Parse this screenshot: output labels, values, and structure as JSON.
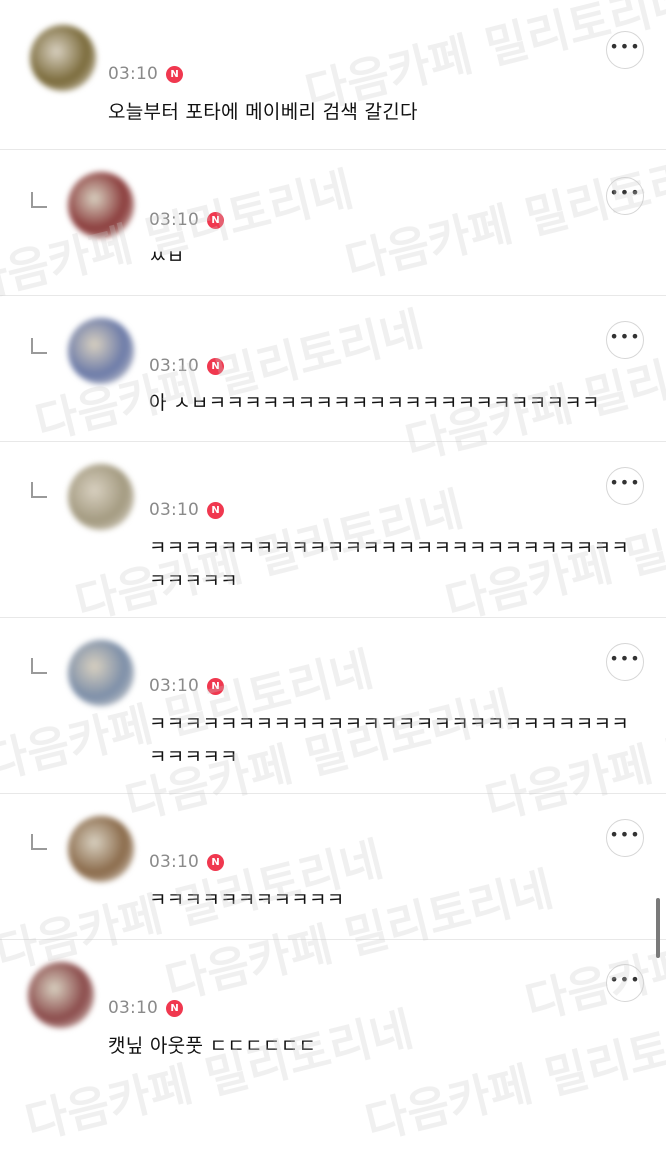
{
  "watermark": "다음카페 밀리토리네",
  "comments": [
    {
      "time": "03:10",
      "badge": "N",
      "text": "오늘부터 포타에 메이베리 검색 갈긴다",
      "avatar_color": "#7a6a3a",
      "reply": false
    },
    {
      "time": "03:10",
      "badge": "N",
      "text": "ㅆㅂ",
      "avatar_color": "#8a3b3b",
      "reply": true
    },
    {
      "time": "03:10",
      "badge": "N",
      "text": "아 ㅅㅂㅋㅋㅋㅋㅋㅋㅋㅋㅋㅋㅋㅋㅋㅋㅋㅋㅋㅋㅋㅋㅋㅋ",
      "avatar_color": "#6b7aa8",
      "reply": true
    },
    {
      "time": "03:10",
      "badge": "N",
      "text": "ㅋㅋㅋㅋㅋㅋㅋㅋㅋㅋㅋㅋㅋㅋㅋㅋㅋㅋㅋㅋㅋㅋㅋㅋㅋㅋㅋㅋㅋㅋㅋㅋ",
      "avatar_color": "#a39a80",
      "reply": true
    },
    {
      "time": "03:10",
      "badge": "N",
      "text": "ㅋㅋㅋㅋㅋㅋㅋㅋㅋㅋㅋㅋㅋㅋㅋㅋㅋㅋㅋㅋㅋㅋㅋㅋㅋㅋㅋㅋㅋㅋㅋㅋ",
      "avatar_color": "#7c8ea8",
      "reply": true
    },
    {
      "time": "03:10",
      "badge": "N",
      "text": "ㅋㅋㅋㅋㅋㅋㅋㅋㅋㅋㅋ",
      "avatar_color": "#8a6a4a",
      "reply": true
    },
    {
      "time": "03:10",
      "badge": "N",
      "text": "캣닢 아웃풋 ㄷㄷㄷㄷㄷㄷ",
      "avatar_color": "#8a4a4a",
      "reply": false
    }
  ]
}
